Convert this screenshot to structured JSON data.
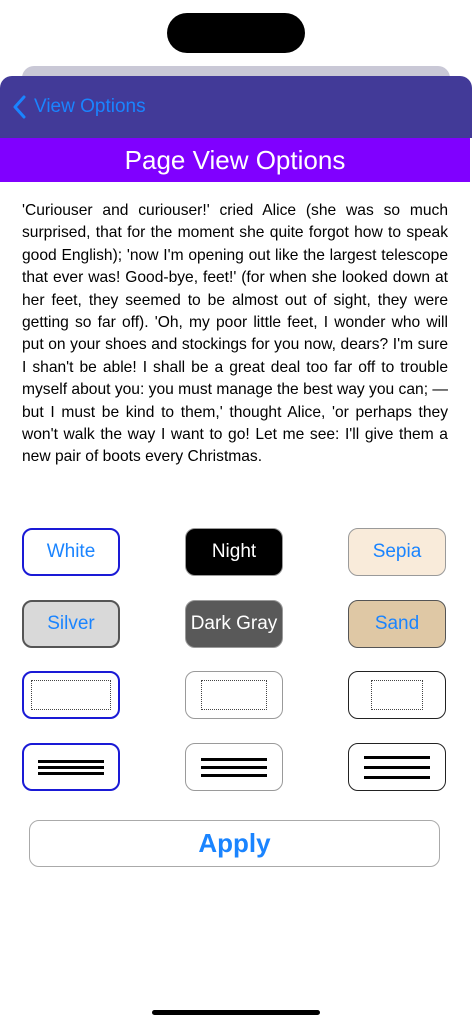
{
  "nav": {
    "back_label": "View Options"
  },
  "header": {
    "title": "Page View Options"
  },
  "passage": "'Curiouser and curiouser!' cried Alice (she was so much surprised, that for the moment she quite forgot how to speak good English); 'now I'm opening out like the largest telescope that ever was! Good-bye, feet!' (for when she looked down at her feet, they seemed to be almost out of sight, they were getting so far off). 'Oh, my poor little feet, I wonder who will put on your shoes and stockings for you now, dears? I'm sure I shan't be able! I shall be a great deal too far off to trouble myself about you: you must manage the best way you can; — but I must be kind to them,' thought Alice, 'or perhaps they won't walk the way I want to go! Let me see: I'll give them a new pair of boots every Christmas.",
  "themes": [
    {
      "label": "White",
      "bg": "#ffffff",
      "fg": "#1a84ff",
      "selected": true
    },
    {
      "label": "Night",
      "bg": "#000000",
      "fg": "#ffffff",
      "selected": false
    },
    {
      "label": "Sepia",
      "bg": "#f9ebda",
      "fg": "#1a84ff",
      "selected": false
    },
    {
      "label": "Silver",
      "bg": "#d9d9d9",
      "fg": "#1a84ff",
      "selected": false
    },
    {
      "label": "Dark Gray",
      "bg": "#595959",
      "fg": "#ffffff",
      "selected": false
    },
    {
      "label": "Sand",
      "bg": "#dfc8a5",
      "fg": "#1a84ff",
      "selected": false
    }
  ],
  "margins": {
    "selected": "large",
    "options": [
      "large",
      "medium",
      "small"
    ]
  },
  "line_spacing": {
    "selected": "compact",
    "options": [
      "compact",
      "normal",
      "wide"
    ]
  },
  "apply_label": "Apply",
  "colors": {
    "navbar": "#423a98",
    "title_bar": "#8000ff",
    "accent": "#1a84ff",
    "selection_border": "#1a1ad6"
  }
}
